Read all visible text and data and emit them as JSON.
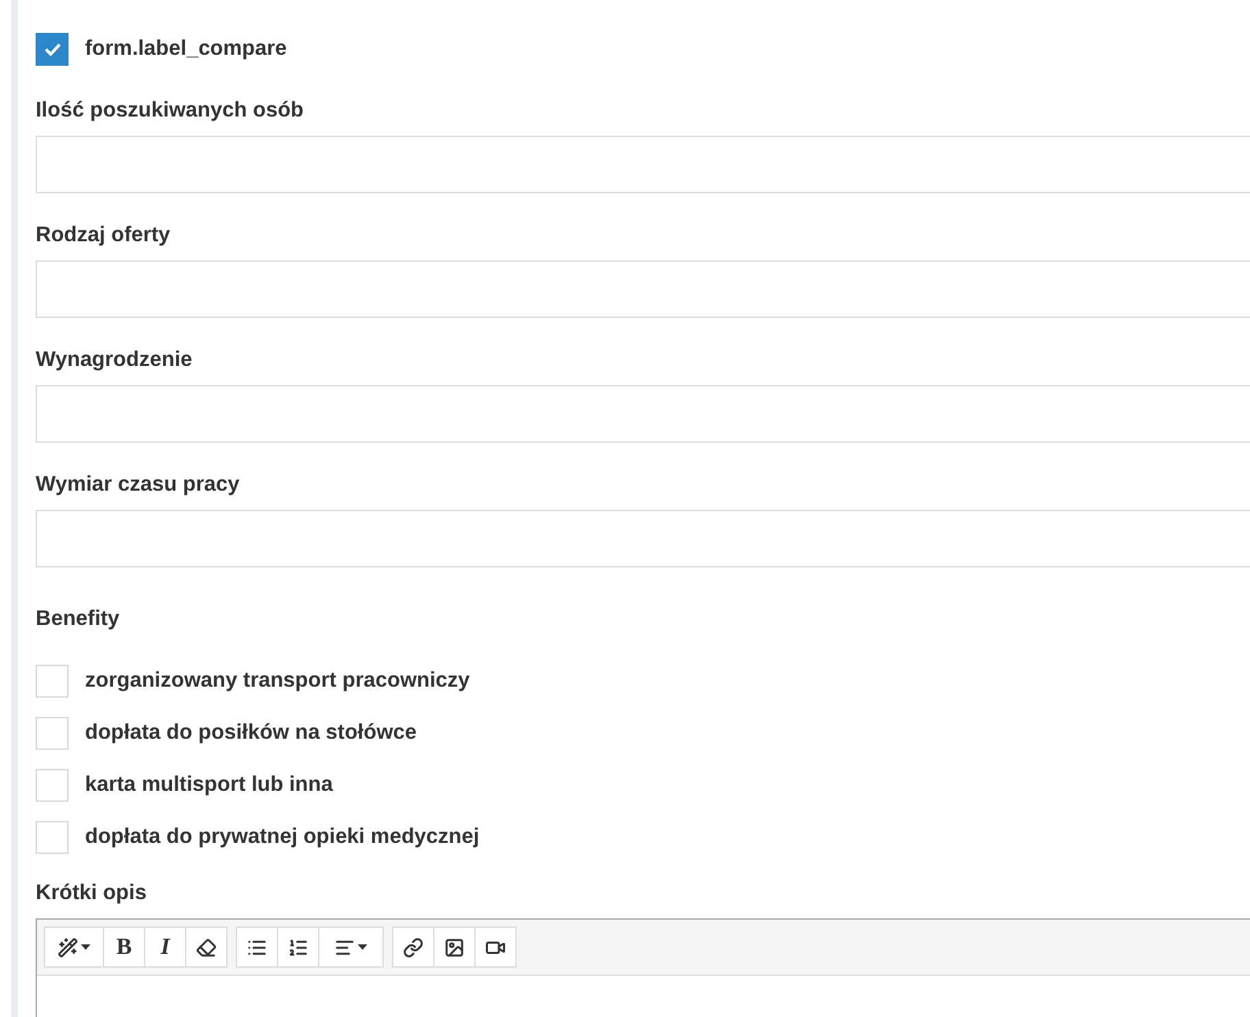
{
  "compare": {
    "label": "form.label_compare",
    "checked": true
  },
  "fields": [
    {
      "label": "Ilość poszukiwanych osób"
    },
    {
      "label": "Rodzaj oferty"
    },
    {
      "label": "Wynagrodzenie"
    },
    {
      "label": "Wymiar czasu pracy"
    }
  ],
  "benefits": {
    "label": "Benefity",
    "options": [
      {
        "label": "zorganizowany transport pracowniczy",
        "checked": false
      },
      {
        "label": "dopłata do posiłków na stołówce",
        "checked": false
      },
      {
        "label": "karta multisport lub inna",
        "checked": false
      },
      {
        "label": "dopłata do prywatnej opieki medycznej",
        "checked": false
      }
    ]
  },
  "editor": {
    "label": "Krótki opis",
    "toolbar": [
      [
        {
          "kind": "style"
        },
        {
          "kind": "text",
          "text": "B"
        },
        {
          "kind": "text",
          "text": "I",
          "italic": true
        },
        {
          "kind": "eraser"
        }
      ],
      [
        {
          "kind": "bullets"
        },
        {
          "kind": "numbers"
        },
        {
          "kind": "align"
        }
      ],
      [
        {
          "kind": "link"
        },
        {
          "kind": "image"
        },
        {
          "kind": "video"
        }
      ]
    ]
  }
}
